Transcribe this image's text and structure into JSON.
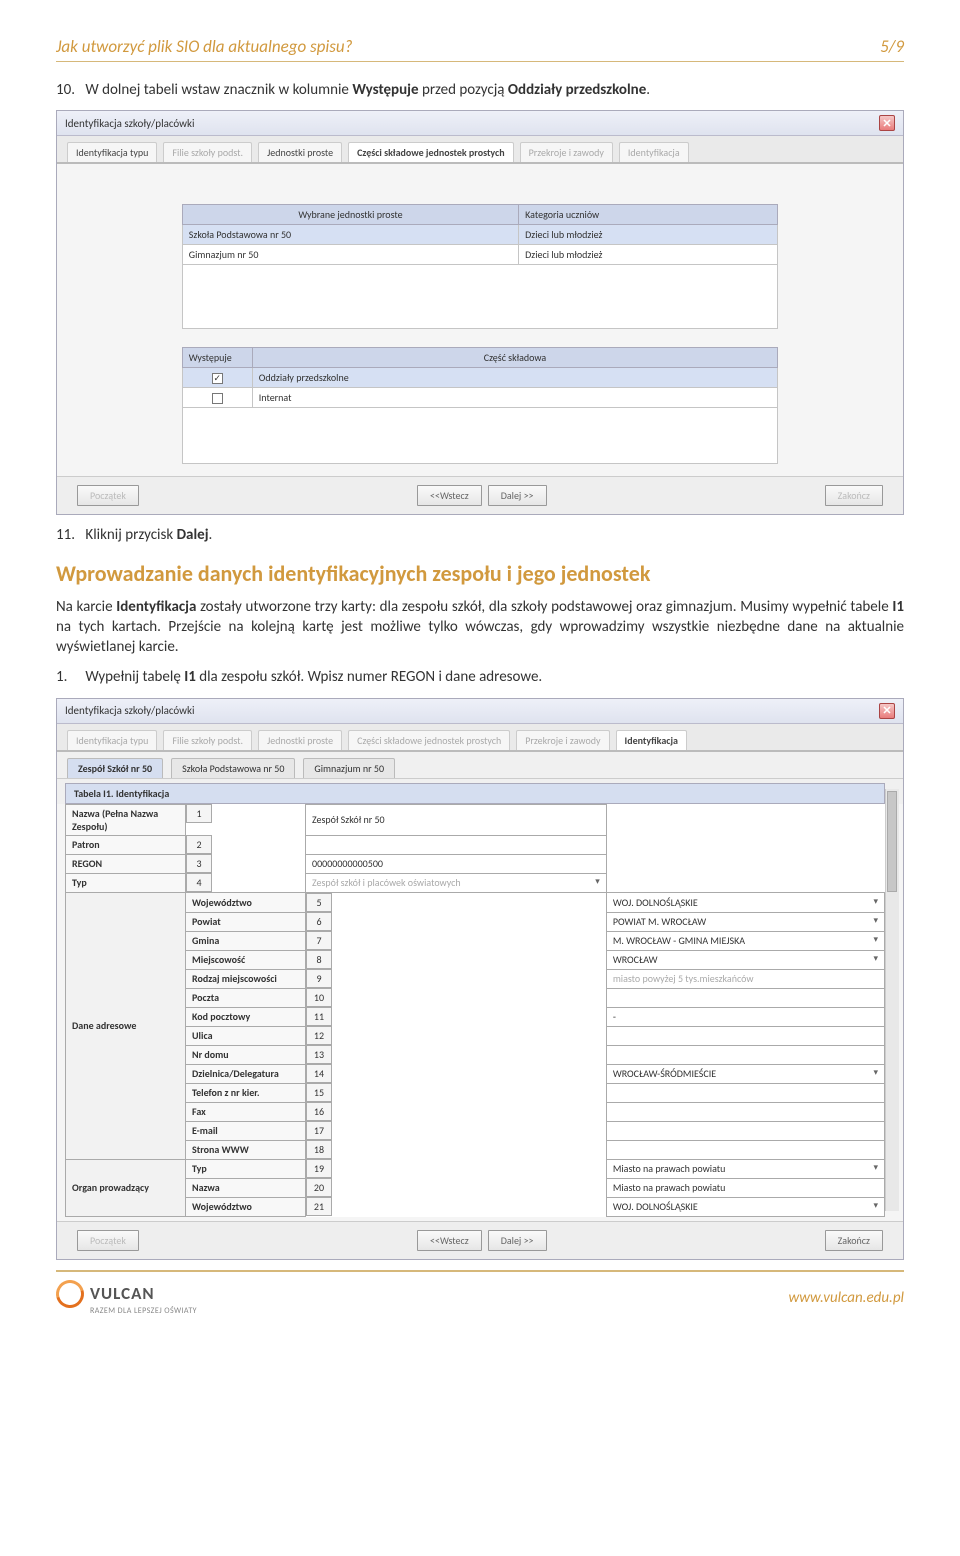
{
  "header": {
    "title": "Jak utworzyć plik SIO dla aktualnego spisu?",
    "pager": "5/9"
  },
  "body": {
    "line10": "W dolnej tabeli wstaw znacznik w kolumnie",
    "line10b": "Występuje",
    "line10c": "przed pozycją",
    "line10d": "Oddziały przedszkolne",
    "line11": "Kliknij przycisk",
    "line11b": "Dalej",
    "heading": "Wprowadzanie danych identyfikacyjnych zespołu i jego jednostek",
    "p1a": "Na karcie",
    "p1b": "Identyfikacja",
    "p1c": "zostały utworzone trzy karty: dla zespołu szkół, dla szkoły podstawowej oraz gimnazjum. Musimy wypełnić tabele",
    "p1d": "I1",
    "p1e": "na tych kartach. Przejście na kolejną kartę jest możliwe tylko wówczas, gdy wprowadzimy wszystkie niezbędne dane na aktualnie wyświetlanej karcie.",
    "step1a": "Wypełnij tabelę",
    "step1b": "I1",
    "step1c": "dla zespołu szkół. Wpisz numer REGON i dane adresowe."
  },
  "dialog1": {
    "title": "Identyfikacja szkoły/placówki",
    "tabs": [
      "Identyfikacja typu",
      "Filie szkoły podst.",
      "Jednostki proste",
      "Części składowe jednostek prostych",
      "Przekroje i zawody",
      "Identyfikacja"
    ],
    "table1": {
      "h": [
        "Wybrane jednostki proste",
        "Kategoria uczniów"
      ],
      "r": [
        [
          "Szkoła Podstawowa nr 50",
          "Dzieci lub młodzież"
        ],
        [
          "Gimnazjum nr 50",
          "Dzieci lub młodzież"
        ]
      ]
    },
    "table2": {
      "h": [
        "Występuje",
        "Część składowa"
      ],
      "r": [
        [
          "✓",
          "Oddziały przedszkolne"
        ],
        [
          "",
          "Internat"
        ]
      ]
    },
    "buttons": {
      "start": "Początek",
      "back": "<<Wstecz",
      "next": "Dalej >>",
      "end": "Zakończ"
    }
  },
  "dialog2": {
    "title": "Identyfikacja szkoły/placówki",
    "tabs": [
      "Identyfikacja typu",
      "Filie szkoły podst.",
      "Jednostki proste",
      "Części składowe jednostek prostych",
      "Przekroje i zawody",
      "Identyfikacja"
    ],
    "subtabs": [
      "Zespół Szkół nr 50",
      "Szkoła Podstawowa nr 50",
      "Gimnazjum nr 50"
    ],
    "section": "Tabela I1. Identyfikacja",
    "rows": [
      [
        "",
        "Nazwa (Pełna Nazwa Zespołu)",
        "1",
        "Zespół Szkół nr 50",
        ""
      ],
      [
        "",
        "Patron",
        "2",
        "",
        ""
      ],
      [
        "",
        "REGON",
        "3",
        "00000000000500",
        ""
      ],
      [
        "",
        "Typ",
        "4",
        "Zespół szkół i placówek oświatowych",
        "dd dim"
      ],
      [
        "Dane adresowe",
        "Województwo",
        "5",
        "WOJ. DOLNOŚLĄSKIE",
        "dd"
      ],
      [
        "",
        "Powiat",
        "6",
        "POWIAT M. WROCŁAW",
        "dd"
      ],
      [
        "",
        "Gmina",
        "7",
        "M. WROCŁAW - GMINA MIEJSKA",
        "dd"
      ],
      [
        "",
        "Miejscowość",
        "8",
        "WROCŁAW",
        "dd"
      ],
      [
        "",
        "Rodzaj miejscowości",
        "9",
        "miasto powyżej 5 tys.mieszkańców",
        "dim"
      ],
      [
        "",
        "Poczta",
        "10",
        "",
        ""
      ],
      [
        "",
        "Kod pocztowy",
        "11",
        "-",
        ""
      ],
      [
        "",
        "Ulica",
        "12",
        "",
        ""
      ],
      [
        "",
        "Nr domu",
        "13",
        "",
        ""
      ],
      [
        "",
        "Dzielnica/Delegatura",
        "14",
        "WROCŁAW-ŚRÓDMIEŚCIE",
        "dd"
      ],
      [
        "",
        "Telefon z nr kier.",
        "15",
        "",
        ""
      ],
      [
        "",
        "Fax",
        "16",
        "",
        ""
      ],
      [
        "",
        "E-mail",
        "17",
        "",
        ""
      ],
      [
        "",
        "Strona WWW",
        "18",
        "",
        ""
      ],
      [
        "Organ prowadzący",
        "Typ",
        "19",
        "Miasto na prawach powiatu",
        "dd"
      ],
      [
        "",
        "Nazwa",
        "20",
        "Miasto na prawach powiatu",
        ""
      ],
      [
        "",
        "Województwo",
        "21",
        "WOJ. DOLNOŚLĄSKIE",
        "dd"
      ]
    ],
    "buttons": {
      "start": "Początek",
      "back": "<<Wstecz",
      "next": "Dalej >>",
      "end": "Zakończ"
    }
  },
  "footer": {
    "logo": "VULCAN",
    "slogan": "RAZEM DLA LEPSZEJ OŚWIATY",
    "url": "www.vulcan.edu.pl"
  }
}
